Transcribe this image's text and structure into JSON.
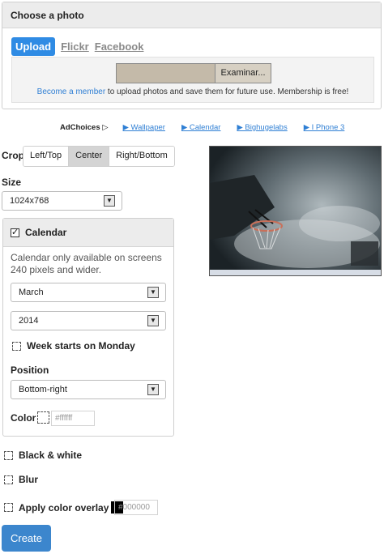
{
  "header": {
    "title": "Choose a photo"
  },
  "tabs": {
    "upload": "Upload",
    "flickr": "Flickr",
    "facebook": "Facebook"
  },
  "upload": {
    "browse_label": "Examinar...",
    "member_link": "Become a member",
    "member_text": " to upload photos and save them for future use. Membership is free!"
  },
  "ads": {
    "adchoices": "AdChoices ▷",
    "links": [
      "▶ Wallpaper",
      "▶ Calendar",
      "▶ Bighugelabs",
      "▶ I Phone 3"
    ]
  },
  "crop": {
    "label": "Crop",
    "options": [
      "Left/Top",
      "Center",
      "Right/Bottom"
    ],
    "selected": "Center"
  },
  "size": {
    "label": "Size",
    "value": "1024x768"
  },
  "calendar": {
    "title": "Calendar",
    "checked": true,
    "note": "Calendar only available on screens 240 pixels and wider.",
    "month": "March",
    "year": "2014",
    "week_label": "Week starts on Monday",
    "position_label": "Position",
    "position_value": "Bottom-right",
    "color_label": "Color",
    "color_placeholder": "#ffffff"
  },
  "options": {
    "black_white": "Black & white",
    "blur": "Blur",
    "overlay": "Apply color overlay",
    "overlay_placeholder": "#000000"
  },
  "actions": {
    "create": "Create"
  },
  "icons": {
    "dropdown": "chevron-down-icon",
    "checkbox": "checkbox-icon"
  },
  "colors": {
    "accent": "#2f8be4",
    "create_button": "#3c86cd",
    "link": "#2f7fd4"
  }
}
